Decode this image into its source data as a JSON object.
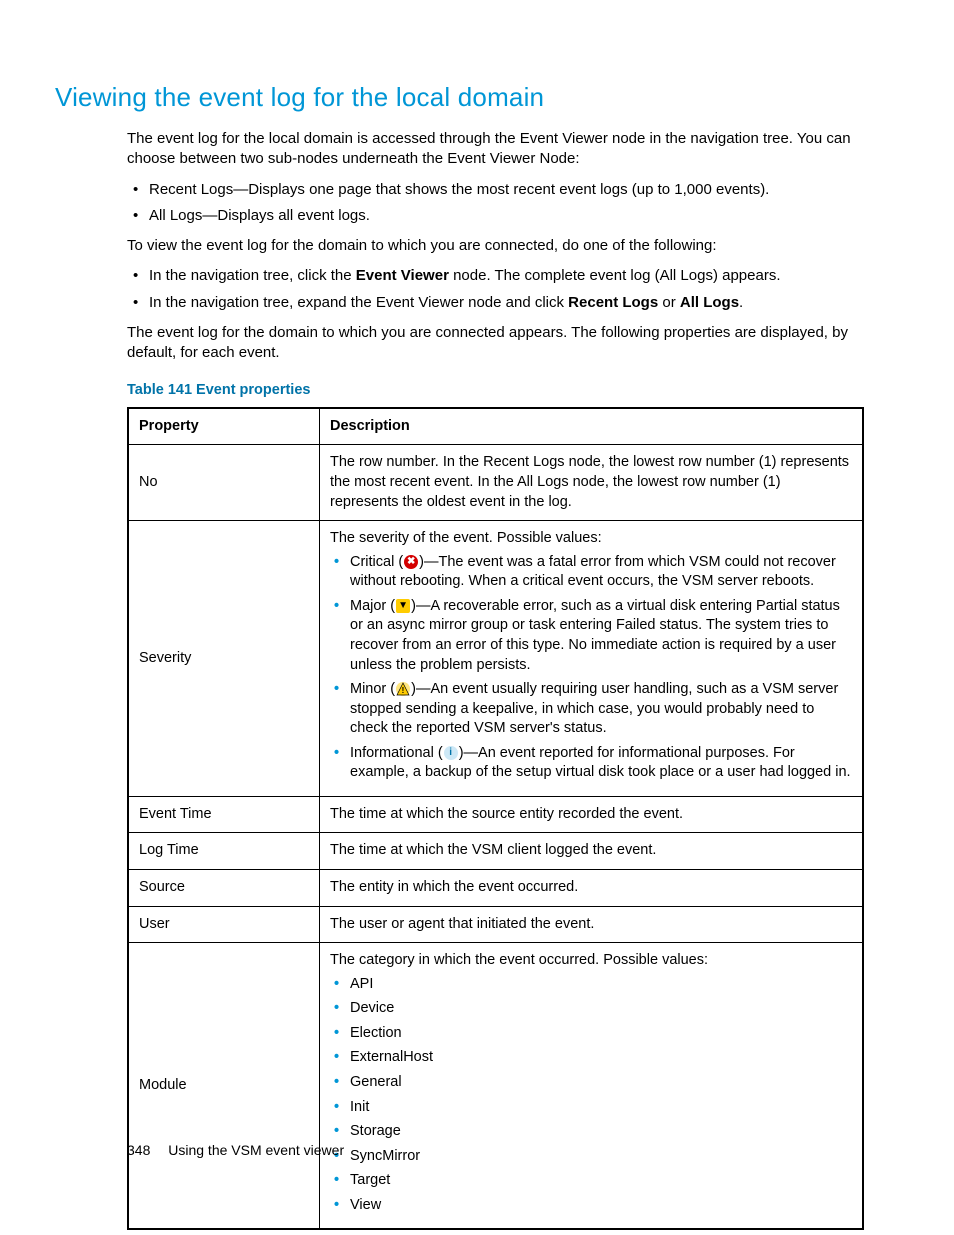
{
  "heading": "Viewing the event log for the local domain",
  "intro": "The event log for the local domain is accessed through the Event Viewer node in the navigation tree. You can choose between two sub-nodes underneath the Event Viewer Node:",
  "subnodes": [
    "Recent Logs—Displays one page that shows the most recent event logs (up to 1,000 events).",
    "All Logs—Displays all event logs."
  ],
  "instr_lead": "To view the event log for the domain to which you are connected, do one of the following:",
  "instr_items": {
    "i0_pre": "In the navigation tree, click the ",
    "i0_b0": "Event Viewer",
    "i0_post": " node. The complete event log (All Logs) appears.",
    "i1_pre": "In the navigation tree, expand the Event Viewer node and click ",
    "i1_b0": "Recent Logs",
    "i1_mid": " or ",
    "i1_b1": "All Logs",
    "i1_post": "."
  },
  "appears": "The event log for the domain to which you are connected appears. The following properties are displayed, by default, for each event.",
  "table_caption": "Table 141 Event properties",
  "table": {
    "head_property": "Property",
    "head_description": "Description",
    "rows": {
      "no": {
        "prop": "No",
        "desc": "The row number. In the Recent Logs node, the lowest row number (1) represents the most recent event. In the All Logs node, the lowest row number (1) represents the oldest event in the log."
      },
      "severity": {
        "prop": "Severity",
        "lead": "The severity of the event. Possible values:",
        "critical_pre": "Critical (",
        "critical_post": ")—The event was a fatal error from which VSM could not recover without rebooting. When a critical event occurs, the VSM server reboots.",
        "major_pre": "Major (",
        "major_post": ")—A recoverable error, such as a virtual disk entering Partial status or an async mirror group or task entering Failed status. The system tries to recover from an error of this type. No immediate action is required by a user unless the problem persists.",
        "minor_pre": "Minor (",
        "minor_post": ")—An event usually requiring user handling, such as a VSM server stopped sending a keepalive, in which case, you would probably need to check the reported VSM server's status.",
        "info_pre": "Informational (",
        "info_post": ")—An event reported for informational purposes. For example, a backup of the setup virtual disk took place or a user had logged in."
      },
      "event_time": {
        "prop": "Event Time",
        "desc": "The time at which the source entity recorded the event."
      },
      "log_time": {
        "prop": "Log Time",
        "desc": "The time at which the VSM client logged the event."
      },
      "source": {
        "prop": "Source",
        "desc": "The entity in which the event occurred."
      },
      "user": {
        "prop": "User",
        "desc": "The user or agent that initiated the event."
      },
      "module": {
        "prop": "Module",
        "lead": "The category in which the event occurred. Possible values:",
        "items": [
          "API",
          "Device",
          "Election",
          "ExternalHost",
          "General",
          "Init",
          "Storage",
          "SyncMirror",
          "Target",
          "View"
        ]
      }
    }
  },
  "footer": {
    "pageno": "348",
    "title": "Using the VSM event viewer"
  }
}
